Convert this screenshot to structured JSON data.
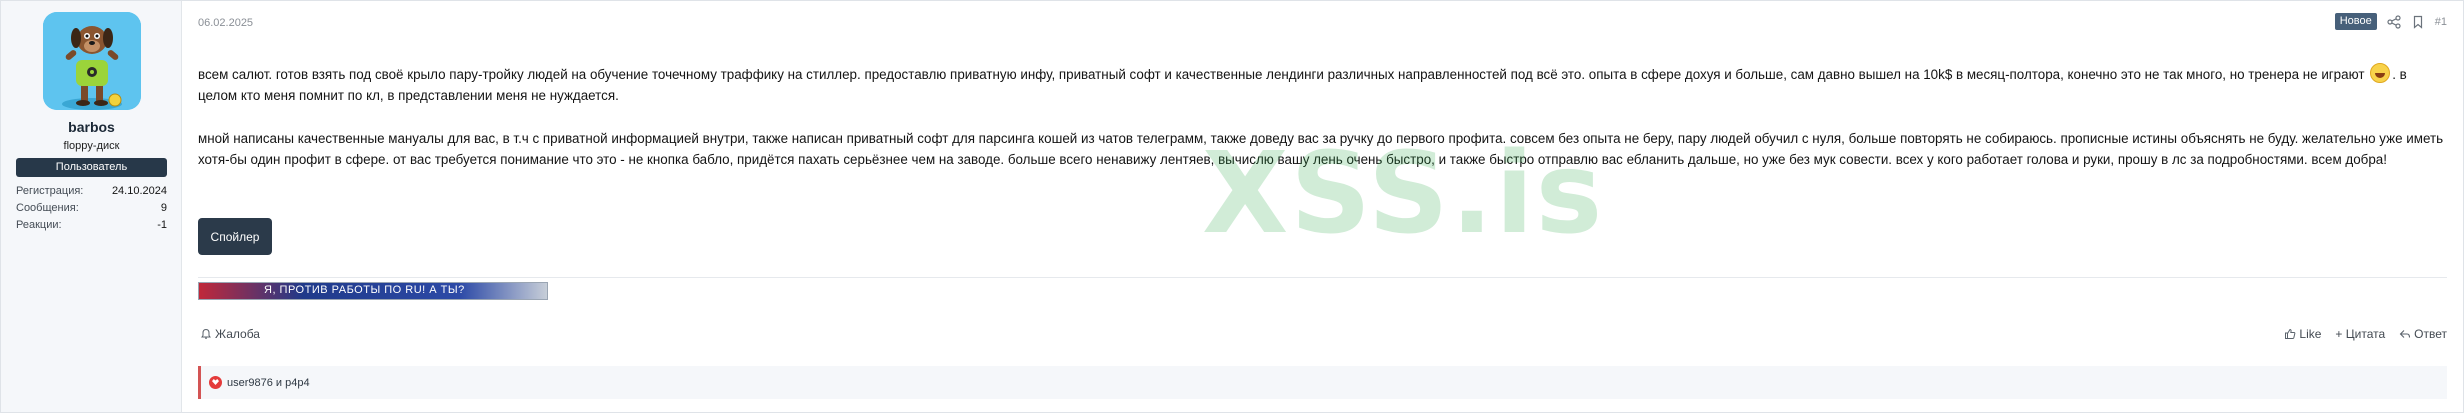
{
  "user": {
    "name": "barbos",
    "title": "floppy-диск",
    "role": "Пользователь",
    "stats": [
      {
        "label": "Регистрация:",
        "value": "24.10.2024"
      },
      {
        "label": "Сообщения:",
        "value": "9"
      },
      {
        "label": "Реакции:",
        "value": "-1"
      }
    ]
  },
  "post": {
    "date": "06.02.2025",
    "badge": "Новое",
    "number": "#1",
    "paragraph1_a": "всем салют. готов взять под своё крыло пару-тройку людей на обучение точечному траффику на стиллер. предоставлю приватную инфу, приватный софт и качественные лендинги различных направленностей под всё это. опыта в сфере дохуя и больше, сам давно вышел на 10k$ в месяц-полтора, конечно это не так много, но тренера не играют ",
    "paragraph1_b": ". в целом кто меня помнит по кл, в представлении меня не нуждается.",
    "paragraph2": "мной написаны качественные мануалы для вас, в т.ч с приватной информацией внутри, также написан приватный софт для парсинга кошей из чатов телеграмм, также доведу вас за ручку до первого профита. совсем без опыта не беру, пару людей обучил с нуля, больше повторять не собираюсь. прописные истины объяснять не буду. желательно уже иметь хотя-бы один профит в сфере. от вас требуется понимание что это - не кнопка бабло, придётся пахать серьёзнее чем на заводе. больше всего ненавижу лентяев, вычислю вашу лень очень быстро, и также быстро отправлю вас ебланить дальше, но уже без мук совести. всех у кого работает голова и руки, прошу в лс за подробностями. всем добра!",
    "spoiler_label": "Спойлер",
    "banner_text": "Я, ПРОТИВ РАБОТЫ ПО RU! А ТЫ?",
    "watermark": "XSS.is"
  },
  "actions": {
    "report": "Жалоба",
    "like": "Like",
    "quote": "+ Цитата",
    "reply": "Ответ"
  },
  "reactions": {
    "text": "user9876 и p4p4"
  },
  "colors": {
    "accent": "#47607a",
    "button": "#2b3a4a",
    "reaction": "#e43b3b"
  }
}
